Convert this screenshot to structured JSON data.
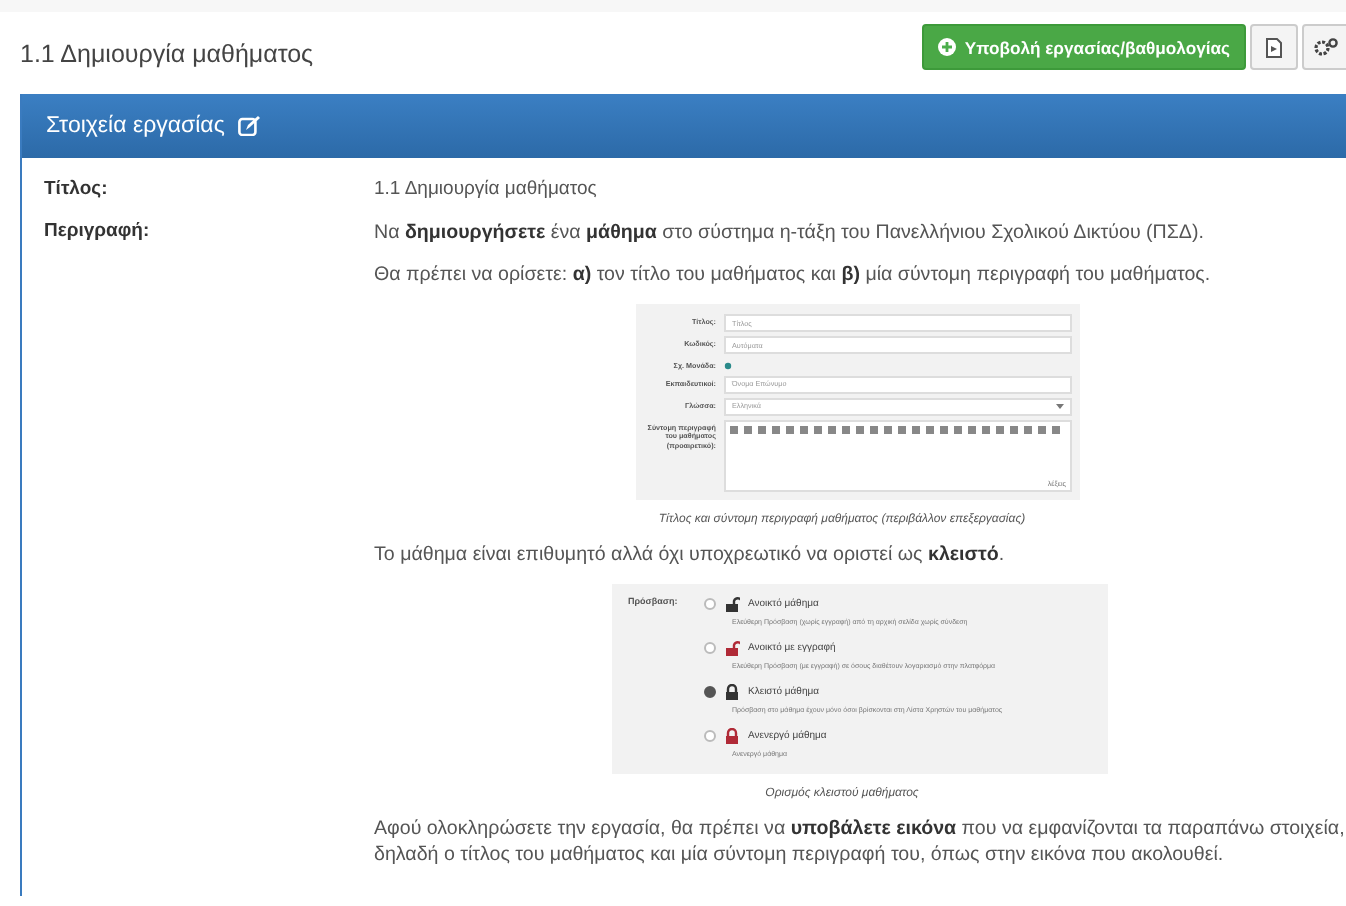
{
  "page_title": "1.1 Δημιουργία μαθήματος",
  "toolbar": {
    "submit_button": "Υποβολή εργασίας/βαθμολογίας"
  },
  "panel": {
    "title": "Στοιχεία εργασίας",
    "rows": [
      {
        "label": "Τίτλος:",
        "kind": "text",
        "text": "1.1 Δημιουργία μαθήματος"
      },
      {
        "label": "Περιγραφή:",
        "kind": "description"
      }
    ]
  },
  "description": [
    {
      "kind": "paragraph",
      "text": "Να **δημιουργήσετε** ένα **μάθημα** στο σύστημα η-τάξη του Πανελλήνιου Σχολικού Δικτύου (ΠΣΔ)."
    },
    {
      "kind": "paragraph",
      "text": "Θα πρέπει να ορίσετε: **α)** τον τίτλο του μαθήματος και **β)** μία σύντομη περιγραφή του μαθήματος."
    },
    {
      "kind": "form_image",
      "caption": "Τίτλος και σύντομη περιγραφή μαθήματος (περιβάλλον επεξεργασίας)",
      "fields": [
        {
          "label": "Τίτλος:",
          "kind": "input",
          "value": "Τίτλος"
        },
        {
          "label": "Κωδικός:",
          "kind": "input",
          "value": "Αυτόματα"
        },
        {
          "label": "Σχ. Μονάδα:",
          "kind": "dot"
        },
        {
          "label": "Εκπαιδευτικοί:",
          "kind": "input",
          "value": "Όνομα Επώνυμο"
        },
        {
          "label": "Γλώσσα:",
          "kind": "select",
          "value": "Ελληνικά"
        },
        {
          "label": "Σύντομη περιγραφή του μαθήματος (προαιρετικό):",
          "kind": "editor",
          "value": "λέξεις"
        }
      ]
    },
    {
      "kind": "paragraph",
      "text": "Το μάθημα είναι επιθυμητό αλλά όχι υποχρεωτικό να οριστεί ως **κλειστό**."
    },
    {
      "kind": "access_image",
      "label": "Πρόσβαση:",
      "caption": "Ορισμός κλειστού μαθήματος",
      "options": [
        {
          "title": "Ανοικτό μάθημα",
          "description": "Ελεύθερη Πρόσβαση (χωρίς εγγραφή) από τη αρχική σελίδα χωρίς σύνδεση",
          "selected": false,
          "locked": false,
          "color": "#333333"
        },
        {
          "title": "Ανοικτό με εγγραφή",
          "description": "Ελεύθερη Πρόσβαση (με εγγραφή) σε όσους διαθέτουν λογαριασμό στην πλατφόρμα",
          "selected": false,
          "locked": false,
          "color": "#b02a37"
        },
        {
          "title": "Κλειστό μάθημα",
          "description": "Πρόσβαση στο μάθημα έχουν μόνο όσοι βρίσκονται στη Λίστα Χρηστών του μαθήματος",
          "selected": true,
          "locked": true,
          "color": "#333333"
        },
        {
          "title": "Ανενεργό μάθημα",
          "description": "Ανενεργό μάθημα",
          "selected": false,
          "locked": true,
          "color": "#b02a37"
        }
      ]
    },
    {
      "kind": "paragraph",
      "text": "Αφού ολοκληρώσετε την εργασία, θα πρέπει να **υποβάλετε εικόνα** που να εμφανίζονται τα παραπάνω στοιχεία, δηλαδή ο τίτλος του μαθήματος και μία σύντομη περιγραφή του, όπως στην εικόνα που ακολουθεί."
    }
  ]
}
